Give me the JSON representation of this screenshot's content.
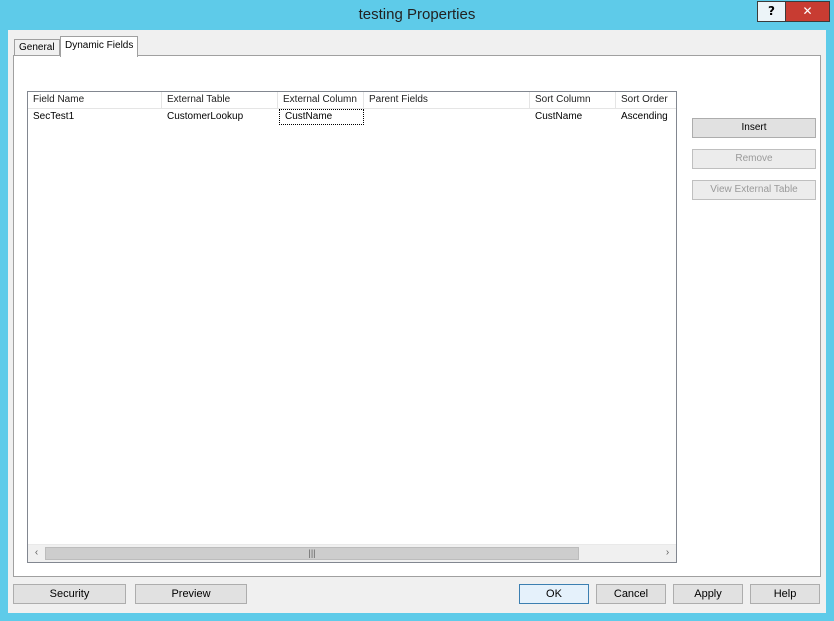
{
  "window": {
    "title": "testing Properties",
    "help_label": "?",
    "close_label": "✕"
  },
  "tabs": [
    {
      "label": "General",
      "selected": false
    },
    {
      "label": "Dynamic Fields",
      "selected": true
    }
  ],
  "table": {
    "columns": [
      "Field Name",
      "External Table",
      "External Column",
      "Parent Fields",
      "Sort Column",
      "Sort Order"
    ],
    "rows": [
      [
        "SecTest1",
        "CustomerLookup",
        "CustName",
        "",
        "CustName",
        "Ascending"
      ]
    ]
  },
  "scrollbar": {
    "left_icon": "‹",
    "right_icon": "›",
    "thumb_grip": "|||"
  },
  "side_buttons": {
    "insert": "Insert",
    "remove": "Remove",
    "view_external": "View External Table"
  },
  "bottom_buttons": {
    "security": "Security",
    "preview": "Preview",
    "ok": "OK",
    "cancel": "Cancel",
    "apply": "Apply",
    "help": "Help"
  },
  "colors": {
    "window_frame": "#5ecbe9",
    "close_button": "#c83c32",
    "default_button_border": "#3c7fb1"
  }
}
